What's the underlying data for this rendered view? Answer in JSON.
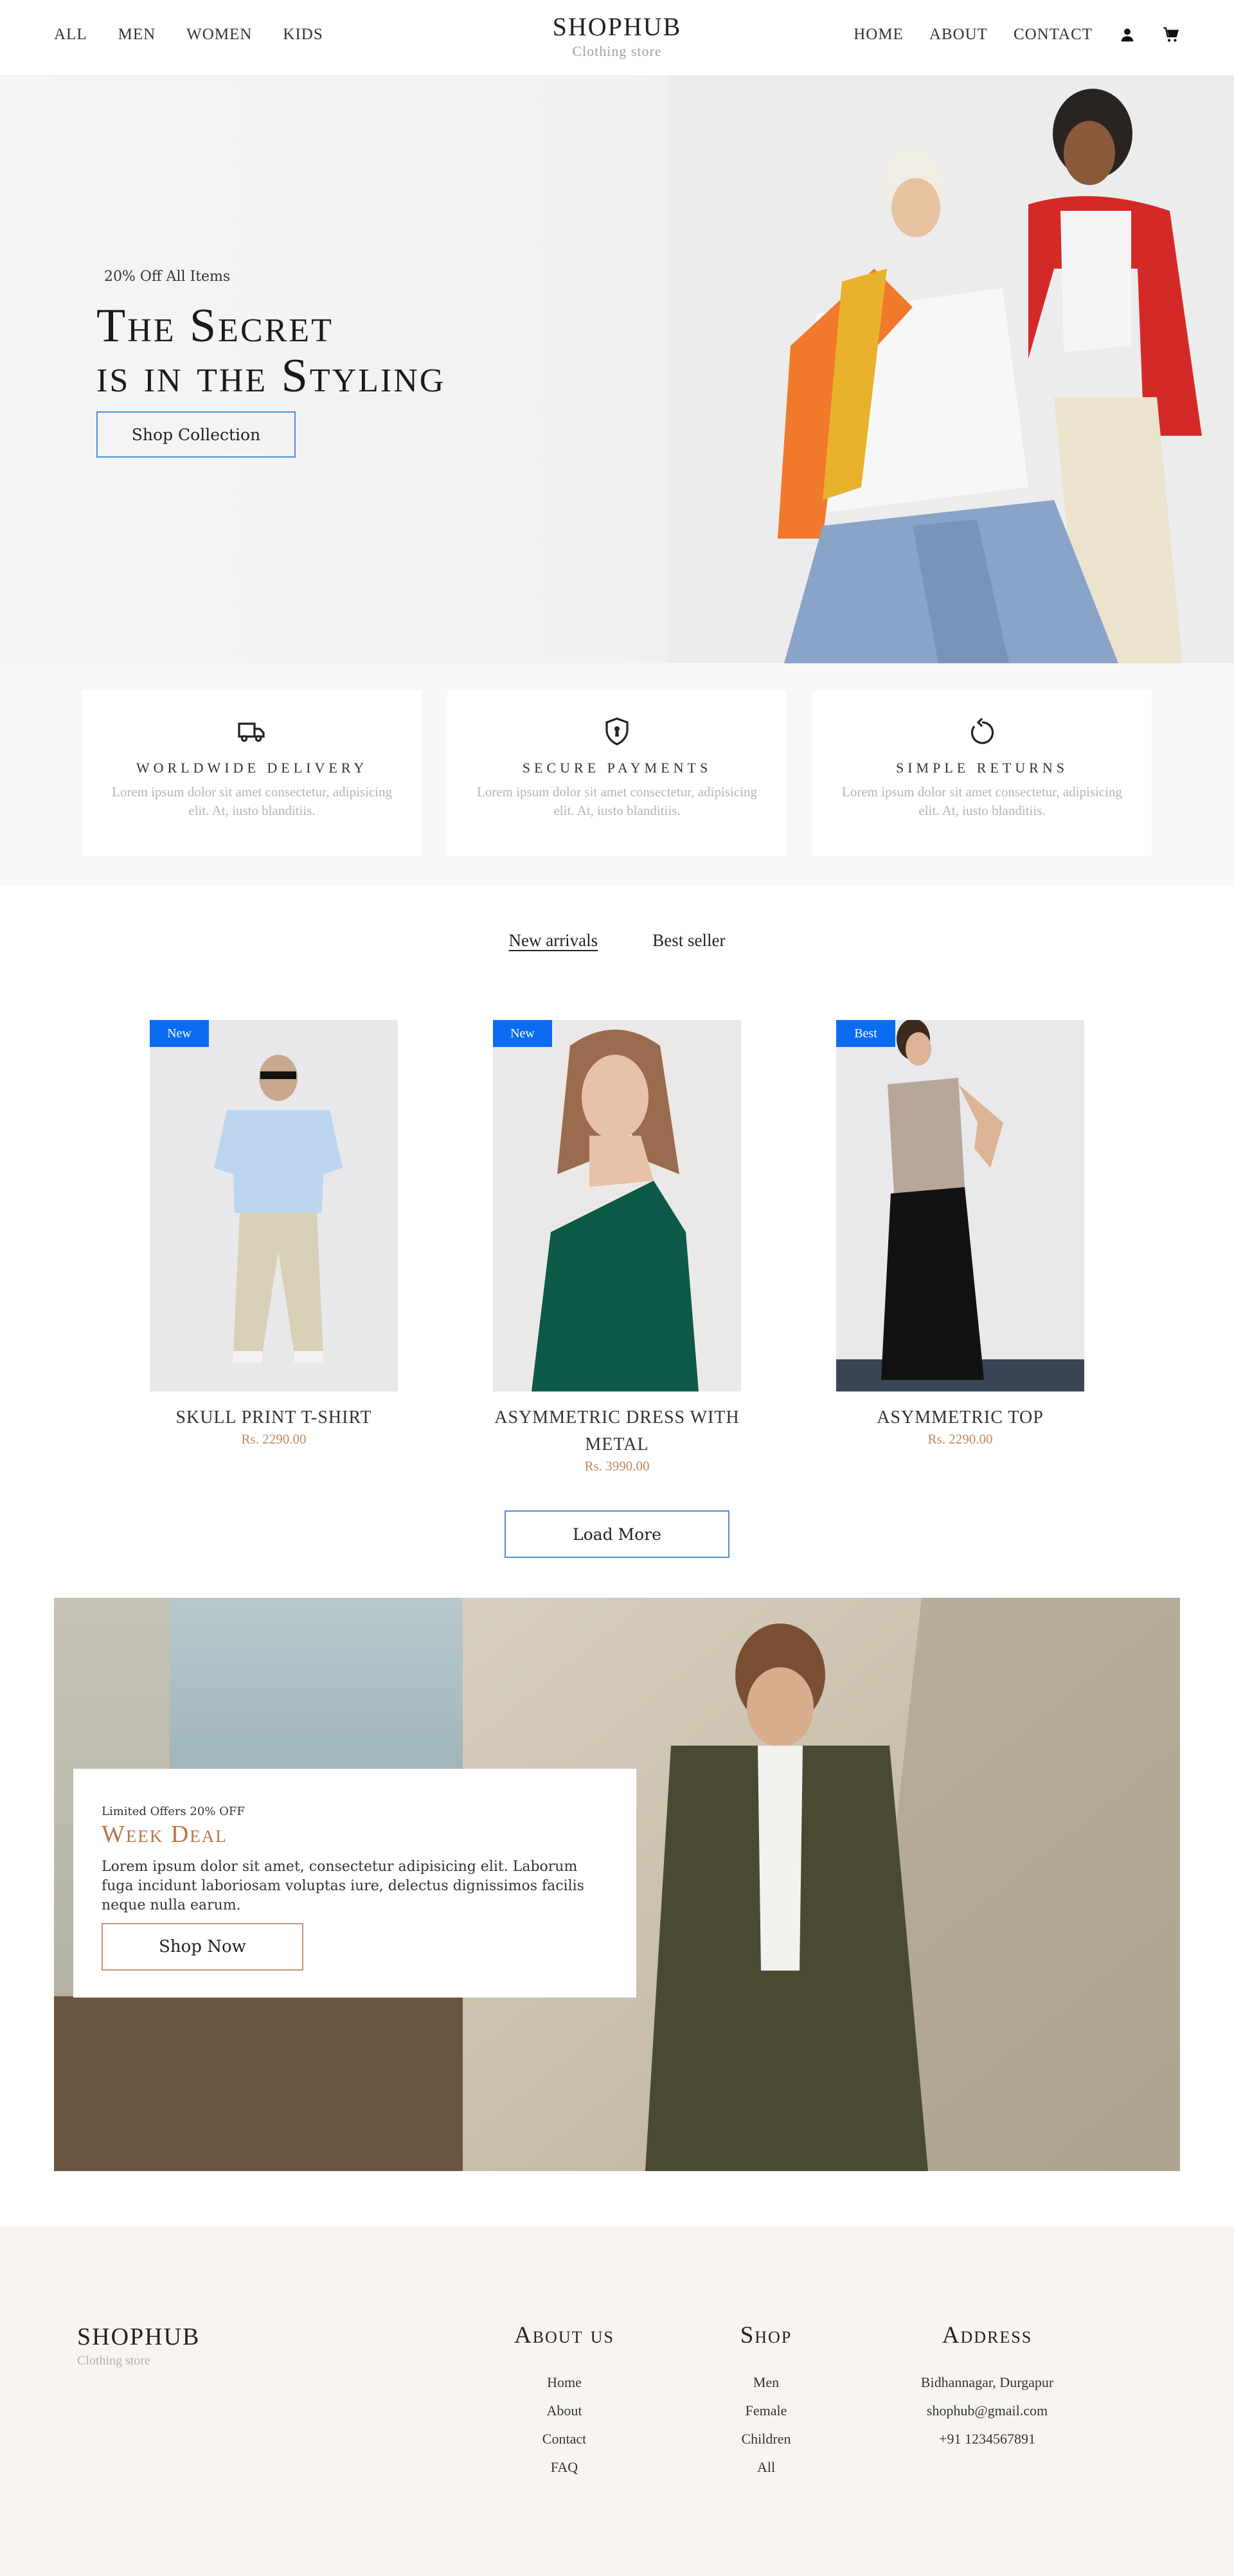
{
  "header": {
    "nav_left": [
      "ALL",
      "MEN",
      "WOMEN",
      "KIDS"
    ],
    "brand_name": "SHOPHUB",
    "brand_sub": "Clothing store",
    "nav_right": [
      "HOME",
      "ABOUT",
      "CONTACT"
    ],
    "icons": [
      "user-icon",
      "cart-icon"
    ]
  },
  "hero": {
    "tag": "20% Off All Items",
    "title_line1": "The Secret",
    "title_line2": "is in the Styling",
    "button": "Shop Collection"
  },
  "features": [
    {
      "icon": "truck-icon",
      "title": "WORLDWIDE DELIVERY",
      "desc": "Lorem ipsum dolor sit amet consectetur, adipisicing elit. At, iusto blanditiis."
    },
    {
      "icon": "shield-icon",
      "title": "SECURE PAYMENTS",
      "desc": "Lorem ipsum dolor sit amet consectetur, adipisicing elit. At, iusto blanditiis."
    },
    {
      "icon": "return-icon",
      "title": "SIMPLE RETURNS",
      "desc": "Lorem ipsum dolor sit amet consectetur, adipisicing elit. At, iusto blanditiis."
    }
  ],
  "tabs": [
    "New arrivals",
    "Best seller"
  ],
  "products": [
    {
      "badge": "New",
      "name": "SKULL PRINT T-SHIRT",
      "price": "Rs. 2290.00"
    },
    {
      "badge": "New",
      "name": "ASYMMETRIC DRESS WITH METAL",
      "price": "Rs. 3990.00"
    },
    {
      "badge": "Best",
      "name": "ASYMMETRIC TOP",
      "price": "Rs. 2290.00"
    }
  ],
  "load_more": "Load More",
  "deal": {
    "tag": "Limited Offers 20% OFF",
    "title": "Week Deal",
    "desc": "Lorem ipsum dolor sit amet, consectetur adipisicing elit. Laborum fuga incidunt laboriosam voluptas iure, delectus dignissimos facilis neque nulla earum.",
    "button": "Shop Now"
  },
  "footer": {
    "brand_name": "SHOPHUB",
    "brand_sub": "Clothing store",
    "about": {
      "title": "About us",
      "links": [
        "Home",
        "About",
        "Contact",
        "FAQ"
      ]
    },
    "shop": {
      "title": "Shop",
      "links": [
        "Men",
        "Female",
        "Children",
        "All"
      ]
    },
    "address": {
      "title": "Address",
      "lines": [
        "Bidhannagar, Durgapur",
        "shophub@gmail.com",
        "+91 1234567891"
      ]
    }
  },
  "colors": {
    "accent_blue": "#0b6cf2",
    "button_border": "#4a90d9",
    "price": "#c08a5e",
    "deal_title": "#b7764b",
    "footer_bg": "#f8f5f1"
  }
}
